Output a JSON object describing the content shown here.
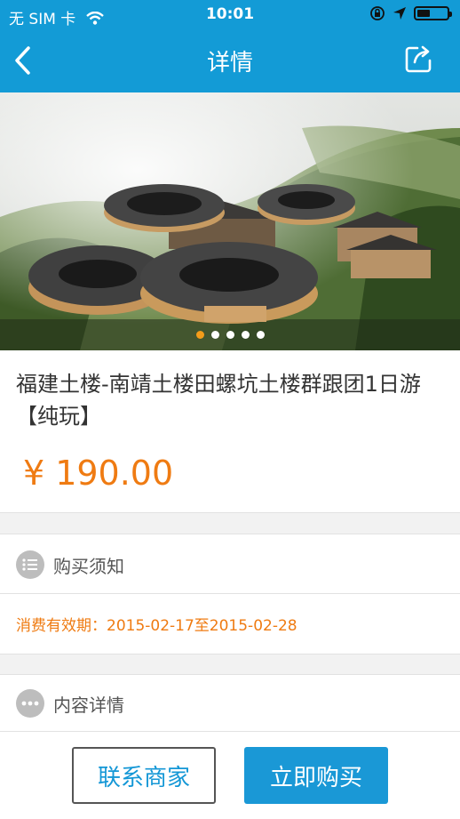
{
  "status_bar": {
    "carrier": "无 SIM 卡",
    "time": "10:01"
  },
  "nav": {
    "title": "详情"
  },
  "banner": {
    "total_slides": 5,
    "active_index": 0
  },
  "product": {
    "title": "福建土楼-南靖土楼田螺坑土楼群跟团1日游【纯玩】",
    "currency": "¥",
    "price": "190.00"
  },
  "purchase_notice": {
    "heading": "购买须知",
    "validity": "消费有效期：2015-02-17至2015-02-28"
  },
  "content_detail": {
    "heading": "内容详情"
  },
  "actions": {
    "contact": "联系商家",
    "buy": "立即购买"
  },
  "colors": {
    "accent": "#139bd6",
    "price": "#ef7b12",
    "buy_button": "#1a98d6"
  }
}
